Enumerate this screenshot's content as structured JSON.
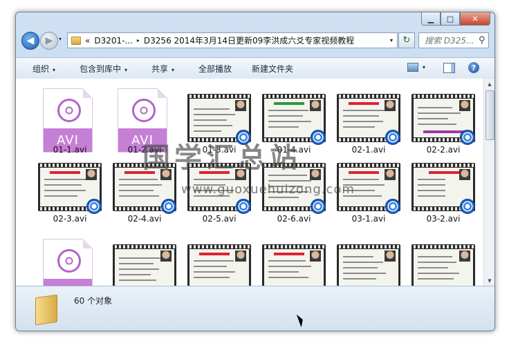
{
  "window": {
    "controls": {
      "minimize": "▁",
      "maximize": "□",
      "close": "✕"
    }
  },
  "nav": {
    "back_icon": "◀",
    "forward_icon": "▶",
    "dropdown": "▾",
    "breadcrumb_prefix": "«",
    "breadcrumbs": [
      "D3201-...",
      "D3256 2014年3月14日更新09李洪成六爻专家视频教程"
    ],
    "crumb_sep": "▸",
    "address_dropdown": "▾",
    "refresh_icon": "↻",
    "search_placeholder": "搜索 D325...",
    "search_icon": "⚲"
  },
  "toolbar": {
    "organize": "组织",
    "include_library": "包含到库中",
    "share": "共享",
    "play_all": "全部播放",
    "new_folder": "新建文件夹",
    "arrow": "▾",
    "help": "?"
  },
  "files": {
    "row1": [
      "01-1.avi",
      "01-2.avi",
      "01-3.avi",
      "01-4.avi",
      "02-1.avi",
      "02-2.avi"
    ],
    "row2": [
      "02-3.avi",
      "02-4.avi",
      "02-5.avi",
      "02-6.avi",
      "03-1.avi",
      "03-2.avi"
    ],
    "avi_badge": "AVI"
  },
  "status": {
    "count": "60 个对象"
  },
  "watermark": {
    "text": "国学汇总站",
    "url": "www.guoxuehuizong.com"
  }
}
